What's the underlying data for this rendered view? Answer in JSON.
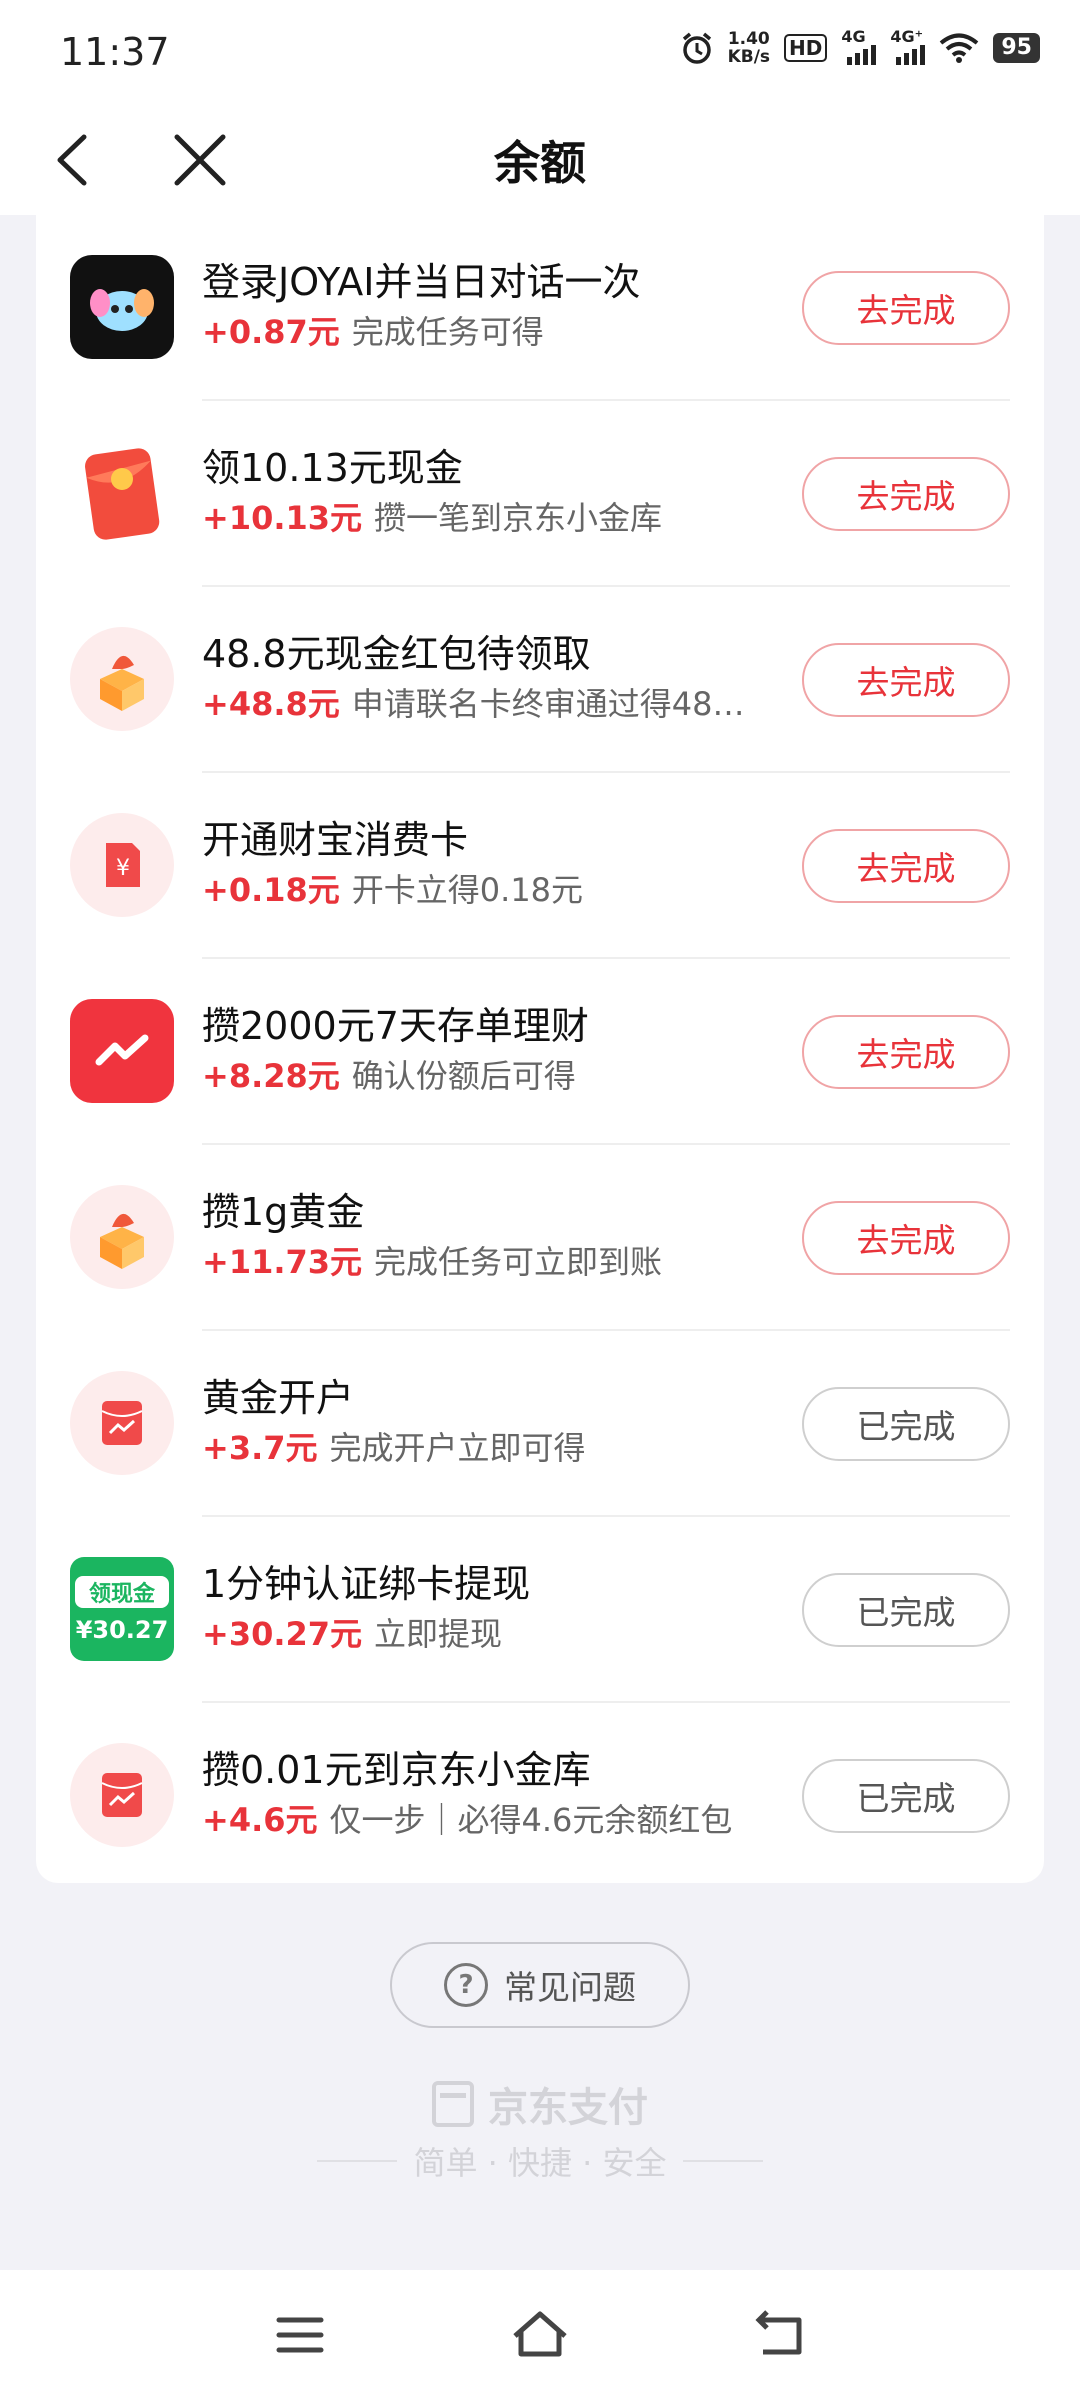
{
  "status_bar": {
    "time": "11:37",
    "net_speed_value": "1.40",
    "net_speed_unit": "KB/s",
    "hd_label": "HD",
    "signal1_label": "4G",
    "signal2_label": "4G⁺",
    "battery": "95"
  },
  "header": {
    "title": "余额",
    "back_icon": "chevron-left-icon",
    "close_icon": "close-icon"
  },
  "tasks": [
    {
      "title": "登录JOYAI并当日对话一次",
      "amount": "+0.87元",
      "desc": "完成任务可得",
      "action": "去完成",
      "status": "todo",
      "icon": "joyai-app-icon"
    },
    {
      "title": "领10.13元现金",
      "amount": "+10.13元",
      "desc": "攒一笔到京东小金库",
      "action": "去完成",
      "status": "todo",
      "icon": "red-envelope-icon"
    },
    {
      "title": "48.8元现金红包待领取",
      "amount": "+48.8元",
      "desc": "申请联名卡终审通过得48…",
      "action": "去完成",
      "status": "todo",
      "icon": "gift-box-icon"
    },
    {
      "title": "开通财宝消费卡",
      "amount": "+0.18元",
      "desc": "开卡立得0.18元",
      "action": "去完成",
      "status": "todo",
      "icon": "yuan-card-icon"
    },
    {
      "title": "攒2000元7天存单理财",
      "amount": "+8.28元",
      "desc": "确认份额后可得",
      "action": "去完成",
      "status": "todo",
      "icon": "trend-chart-icon"
    },
    {
      "title": "攒1g黄金",
      "amount": "+11.73元",
      "desc": "完成任务可立即到账",
      "action": "去完成",
      "status": "todo",
      "icon": "gift-box-icon"
    },
    {
      "title": "黄金开户",
      "amount": "+3.7元",
      "desc": "完成开户立即可得",
      "action": "已完成",
      "status": "done",
      "icon": "red-packet-trend-icon"
    },
    {
      "title": "1分钟认证绑卡提现",
      "amount": "+30.27元",
      "desc": "立即提现",
      "action": "已完成",
      "status": "done",
      "icon": "cash-badge-icon",
      "badge_top": "领现金",
      "badge_bottom": "¥30.27"
    },
    {
      "title": "攒0.01元到京东小金库",
      "amount": "+4.6元",
      "desc": "仅一步｜必得4.6元余额红包",
      "action": "已完成",
      "status": "done",
      "icon": "red-packet-trend-icon"
    }
  ],
  "faq": {
    "label": "常见问题"
  },
  "footer": {
    "brand": "京东支付",
    "slogan": "简单 · 快捷 · 安全"
  },
  "colors": {
    "accent": "#e8333a",
    "page_bg": "#f2f2f7"
  }
}
